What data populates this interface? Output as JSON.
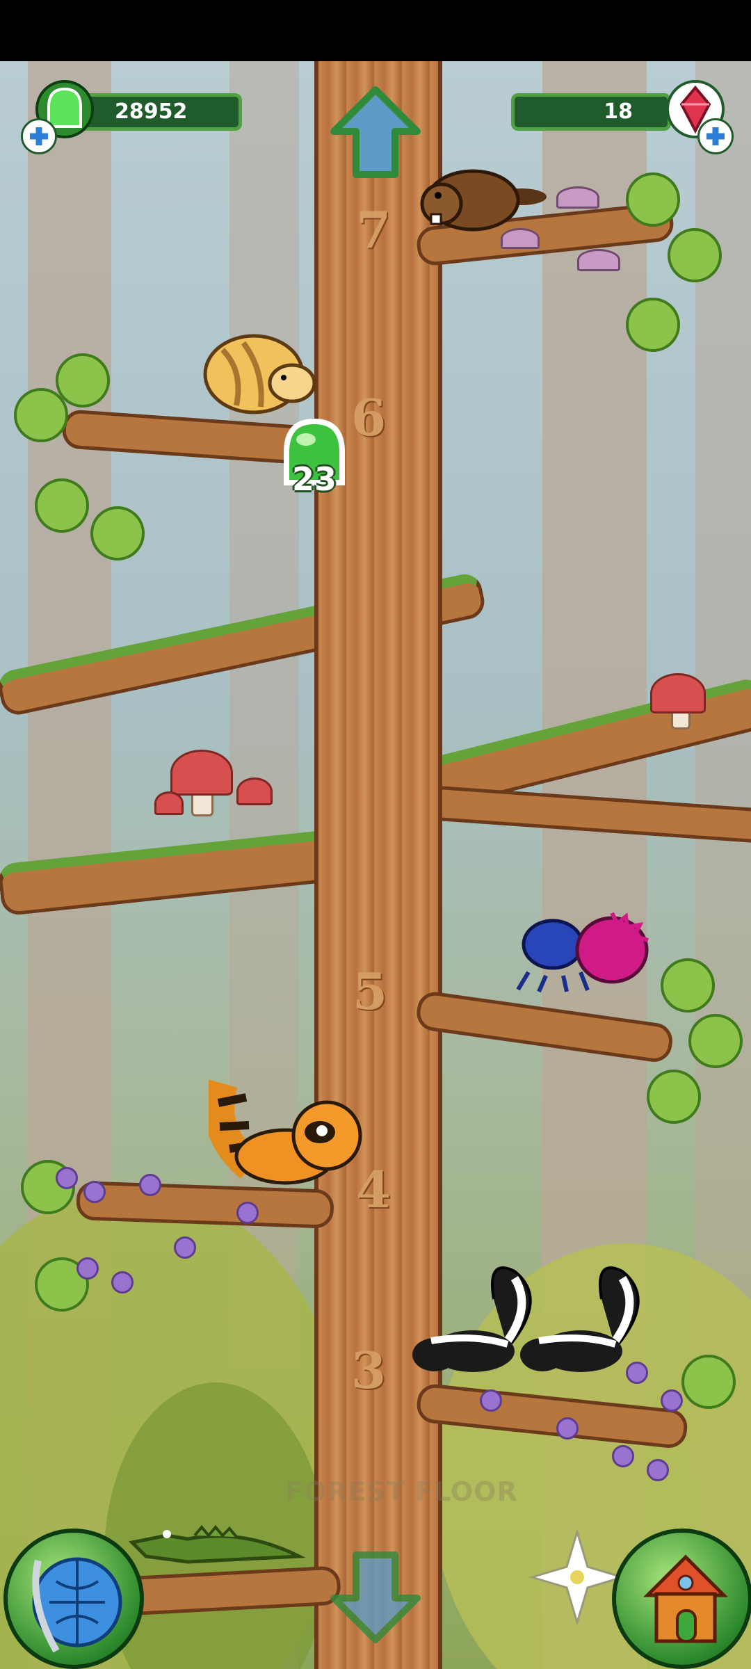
{
  "hud": {
    "currency_amount": "28952",
    "gem_amount": "18",
    "currency_icon": "green-jelly-icon",
    "gem_icon": "red-gem-icon",
    "plus_icon": "plus-icon"
  },
  "floors": [
    "7",
    "6",
    "5",
    "4",
    "3"
  ],
  "collect_badge": {
    "amount": "23"
  },
  "bottom_nav": {
    "left_button": "globe-icon",
    "right_button": "house-icon"
  },
  "watermark_text": "FOREST FLOOR",
  "colors": {
    "hud_fill": "#1f5b2b",
    "hud_border": "#4fa141",
    "trunk": "#c9874f",
    "jelly": "#4cd44a",
    "gem": "#e0334f"
  }
}
